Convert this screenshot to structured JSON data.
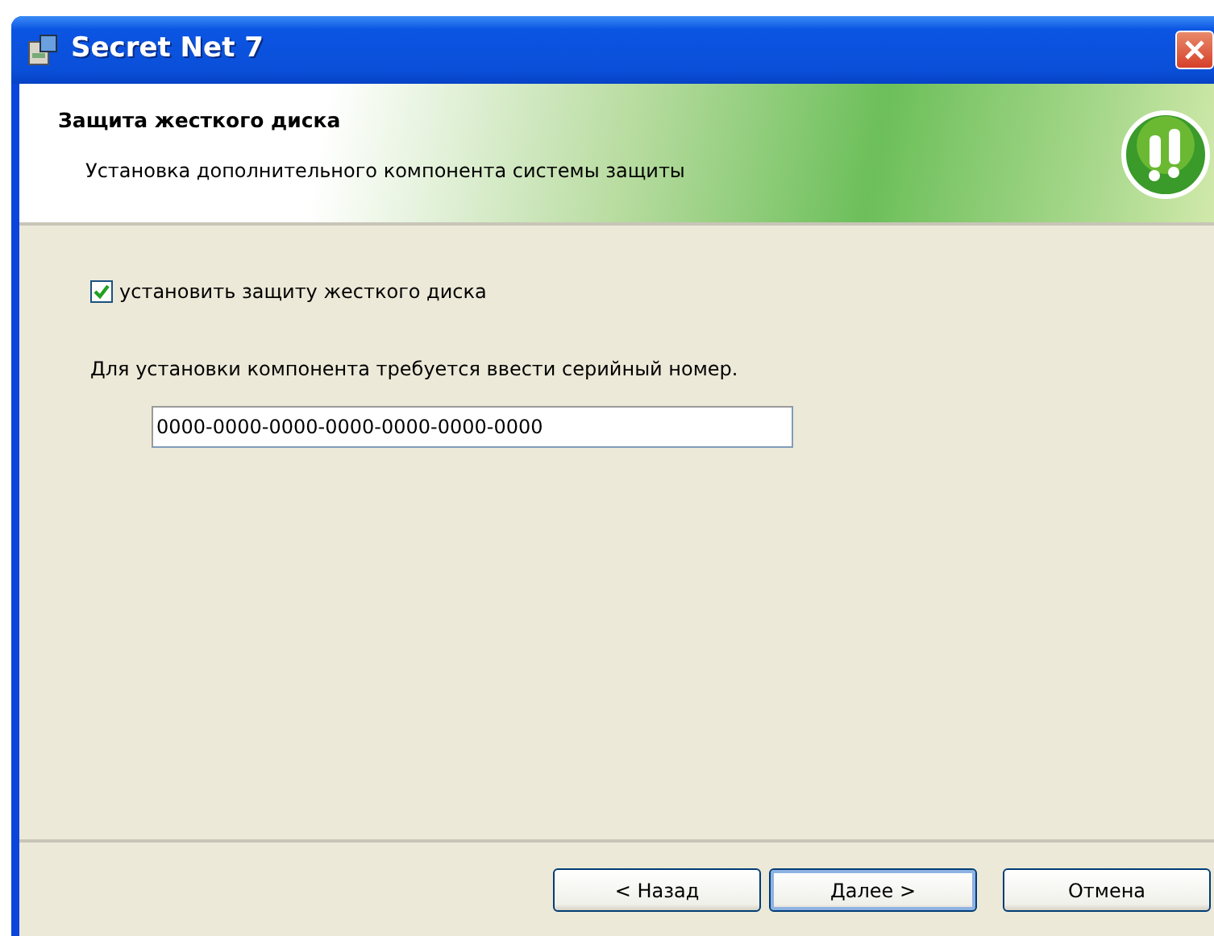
{
  "window": {
    "title": "Secret Net 7"
  },
  "header": {
    "title": "Защита жесткого диска",
    "subtitle": "Установка дополнительного компонента системы защиты"
  },
  "checkbox": {
    "label": "установить защиту жесткого диска",
    "checked": true
  },
  "serial": {
    "prompt": "Для установки компонента требуется ввести серийный номер.",
    "value": "0000-0000-0000-0000-0000-0000-0000"
  },
  "buttons": [
    {
      "label": "< Назад",
      "default": false
    },
    {
      "label": "Далее >",
      "default": true
    },
    {
      "label": "Отмена",
      "default": false
    }
  ]
}
